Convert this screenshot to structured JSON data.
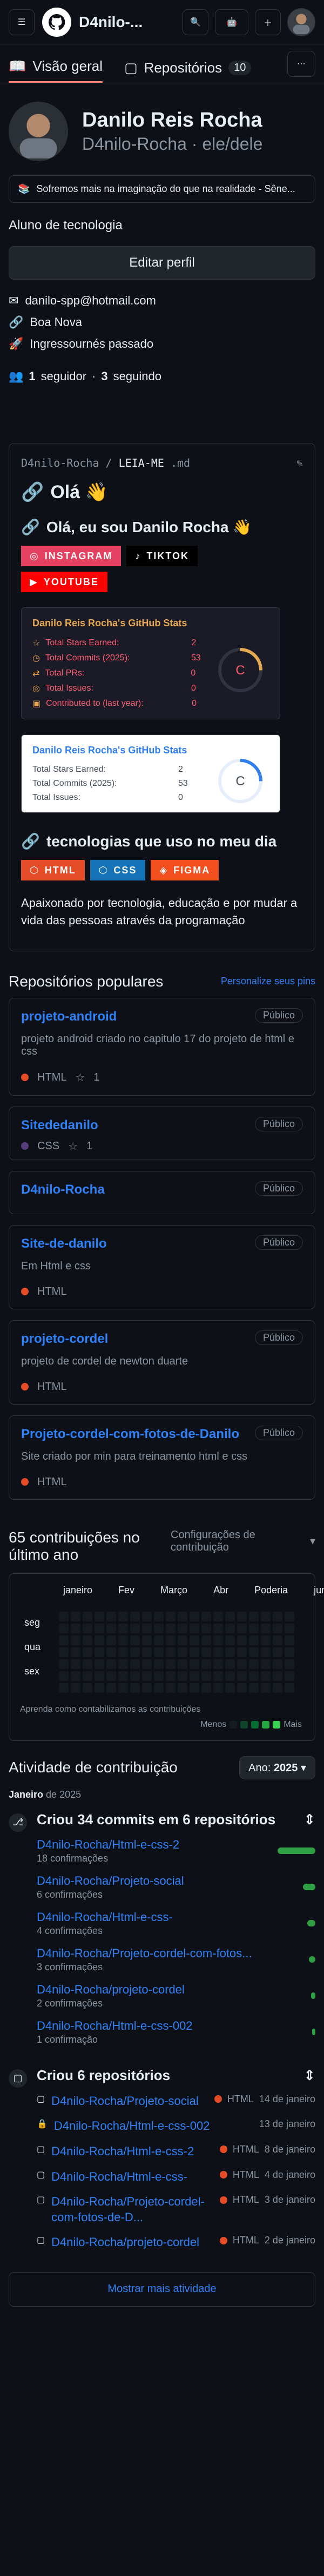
{
  "header": {
    "title": "D4nilo-...",
    "avatar_alt": "Perfil"
  },
  "tabs": [
    {
      "label": "Visão geral"
    },
    {
      "label": "Repositórios",
      "count": "10"
    }
  ],
  "profile": {
    "name": "Danilo Reis Rocha",
    "login": "D4nilo-Rocha · ele/dele",
    "status": "Sofremos mais na imaginação do que na realidade - Sêne...",
    "bio": "Aluno de tecnologia",
    "edit_label": "Editar perfil",
    "email": "danilo-spp@hotmail.com",
    "location": "Boa Nova",
    "org": "Ingressournés passado",
    "followers": "1",
    "followers_label": "seguidor",
    "following": "3",
    "following_label": "seguindo"
  },
  "readme": {
    "path_user": "D4nilo-Rocha",
    "path_file": "LEIA-ME",
    "path_ext": ".md",
    "hello": "Olá 👋",
    "intro": "Olá, eu sou Danilo Rocha 👋",
    "badge_instagram": "INSTAGRAM",
    "badge_tiktok": "TIKTOK",
    "badge_youtube": "YOUTUBE",
    "stats1": {
      "title": "Danilo Reis Rocha's GitHub Stats",
      "stars_label": "Total Stars Earned:",
      "stars": "2",
      "commits_label": "Total Commits (2025):",
      "commits": "53",
      "prs_label": "Total PRs:",
      "prs": "0",
      "issues_label": "Total Issues:",
      "issues": "0",
      "contrib_label": "Contributed to (last year):",
      "contrib": "0",
      "grade": "C"
    },
    "stats2": {
      "title": "Danilo Reis Rocha's GitHub Stats",
      "stars_label": "Total Stars Earned:",
      "stars": "2",
      "commits_label": "Total Commits (2025):",
      "commits": "53",
      "issues_label": "Total Issues:",
      "issues": "0",
      "grade": "C"
    },
    "tech_title": "tecnologias que uso no meu dia",
    "tech_html": "HTML",
    "tech_css": "CSS",
    "tech_figma": "FIGMA",
    "desc": "Apaixonado por tecnologia, educação e por mudar a vida das pessoas através da programação"
  },
  "popular": {
    "title": "Repositórios populares",
    "customize": "Personalize seus pins",
    "repos": [
      {
        "name": "projeto-android",
        "badge": "Público",
        "desc": "projeto android criado no capitulo 17 do projeto de html e css",
        "lang": "HTML",
        "stars": "1"
      },
      {
        "name": "Sitededanilo",
        "badge": "Público",
        "desc": "",
        "lang": "CSS",
        "stars": "1"
      },
      {
        "name": "D4nilo-Rocha",
        "badge": "Público",
        "desc": "",
        "lang": "",
        "stars": ""
      },
      {
        "name": "Site-de-danilo",
        "badge": "Público",
        "desc": "Em Html e css",
        "lang": "HTML",
        "stars": ""
      },
      {
        "name": "projeto-cordel",
        "badge": "Público",
        "desc": "projeto de cordel de newton duarte",
        "lang": "HTML",
        "stars": ""
      },
      {
        "name": "Projeto-cordel-com-fotos-de-Danilo",
        "badge": "Público",
        "desc": "Site criado por min para treinamento html e css",
        "lang": "HTML",
        "stars": ""
      }
    ]
  },
  "contrib": {
    "title": "65 contribuições no último ano",
    "settings": "Configurações de contribuição",
    "months": [
      "janeiro",
      "Fev",
      "Março",
      "Abr",
      "Poderia",
      "junho"
    ],
    "days": [
      "seg",
      "qua",
      "sex"
    ],
    "learn": "Aprenda como contabilizamos as contribuições",
    "less": "Menos",
    "more": "Mais"
  },
  "activity": {
    "title": "Atividade de contribuição",
    "year_label": "Ano:",
    "year": "2025",
    "month": "Janeiro",
    "month_year": "de 2025",
    "commits_title": "Criou 34 commits em 6 repositórios",
    "commits": [
      {
        "repo": "D4nilo-Rocha/Html-e-css-2",
        "count": "18 confirmações",
        "bar": 1.0
      },
      {
        "repo": "D4nilo-Rocha/Projeto-social",
        "count": "6 confirmações",
        "bar": 0.33
      },
      {
        "repo": "D4nilo-Rocha/Html-e-css-",
        "count": "4 confirmações",
        "bar": 0.22
      },
      {
        "repo": "D4nilo-Rocha/Projeto-cordel-com-fotos...",
        "count": "3 confirmações",
        "bar": 0.17
      },
      {
        "repo": "D4nilo-Rocha/projeto-cordel",
        "count": "2 confirmações",
        "bar": 0.11
      },
      {
        "repo": "D4nilo-Rocha/Html-e-css-002",
        "count": "1 confirmação",
        "bar": 0.06
      }
    ],
    "repos_title": "Criou 6 repositórios",
    "repos": [
      {
        "name": "D4nilo-Rocha/Projeto-social",
        "lang": "HTML",
        "date": "14 de janeiro"
      },
      {
        "name": "D4nilo-Rocha/Html-e-css-002",
        "lang": "",
        "date": "13 de janeiro"
      },
      {
        "name": "D4nilo-Rocha/Html-e-css-2",
        "lang": "HTML",
        "date": "8 de janeiro"
      },
      {
        "name": "D4nilo-Rocha/Html-e-css-",
        "lang": "HTML",
        "date": "4 de janeiro"
      },
      {
        "name": "D4nilo-Rocha/Projeto-cordel-com-fotos-de-D...",
        "lang": "HTML",
        "date": "3 de janeiro"
      },
      {
        "name": "D4nilo-Rocha/projeto-cordel",
        "lang": "HTML",
        "date": "2 de janeiro"
      }
    ],
    "more": "Mostrar mais atividade"
  },
  "colors": {
    "bg": "#0d1117",
    "link": "#2f81f7",
    "html": "#e34c26",
    "css": "#563d7c",
    "green": "#2ea043",
    "instagram": "#e4405f",
    "youtube": "#ff0000",
    "tiktok": "#000000",
    "figma": "#f24e1e"
  }
}
